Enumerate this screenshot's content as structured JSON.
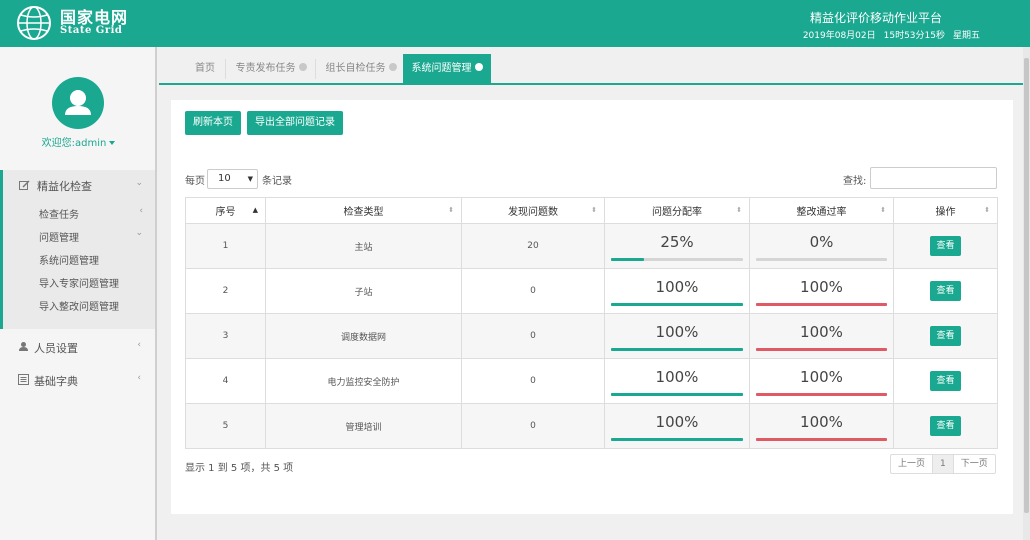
{
  "header": {
    "logo_cn": "国家电网",
    "logo_en": "State Grid",
    "platform_title": "精益化评价移动作业平台",
    "date": "2019年08月02日",
    "time": "15时53分15秒",
    "weekday": "星期五",
    "brand_color": "#1aa890"
  },
  "sidebar": {
    "welcome": "欢迎您:admin",
    "section": {
      "label": "精益化检查",
      "icon": "edit-icon"
    },
    "sub_items": [
      {
        "label": "检查任务",
        "chevron": "‹"
      },
      {
        "label": "问题管理",
        "chevron": "›"
      },
      {
        "label": "系统问题管理"
      },
      {
        "label": "导入专家问题管理"
      },
      {
        "label": "导入整改问题管理"
      }
    ],
    "items": [
      {
        "label": "人员设置",
        "icon": "user-icon"
      },
      {
        "label": "基础字典",
        "icon": "list-icon"
      }
    ]
  },
  "tabs": [
    {
      "label": "首页",
      "closable": false
    },
    {
      "label": "专责发布任务",
      "closable": true
    },
    {
      "label": "组长自检任务",
      "closable": true
    },
    {
      "label": "系统问题管理",
      "closable": true,
      "active": true
    }
  ],
  "toolbar": {
    "refresh_label": "刷新本页",
    "export_label": "导出全部问题记录"
  },
  "length_control": {
    "prefix": "每页",
    "value": "10",
    "suffix": "条记录"
  },
  "search": {
    "label": "查找:",
    "value": ""
  },
  "table": {
    "headers": [
      "序号",
      "检查类型",
      "发现问题数",
      "问题分配率",
      "整改通过率",
      "操作"
    ],
    "rows": [
      {
        "no": "1",
        "type": "主站",
        "count": "20",
        "assign": "25%",
        "assign_value": 25,
        "pass": "0%",
        "pass_value": 0,
        "action": "查看"
      },
      {
        "no": "2",
        "type": "子站",
        "count": "0",
        "assign": "100%",
        "assign_value": 100,
        "pass": "100%",
        "pass_value": 100,
        "action": "查看"
      },
      {
        "no": "3",
        "type": "调度数据网",
        "count": "0",
        "assign": "100%",
        "assign_value": 100,
        "pass": "100%",
        "pass_value": 100,
        "action": "查看"
      },
      {
        "no": "4",
        "type": "电力监控安全防护",
        "count": "0",
        "assign": "100%",
        "assign_value": 100,
        "pass": "100%",
        "pass_value": 100,
        "action": "查看"
      },
      {
        "no": "5",
        "type": "管理培训",
        "count": "0",
        "assign": "100%",
        "assign_value": 100,
        "pass": "100%",
        "pass_value": 100,
        "action": "查看"
      }
    ],
    "assign_bar_color": "#1aa890",
    "pass_bar_color": "#e05a65"
  },
  "footer": {
    "info": "显示 1 到 5 项，共 5 项",
    "prev": "上一页",
    "page": "1",
    "next": "下一页"
  }
}
